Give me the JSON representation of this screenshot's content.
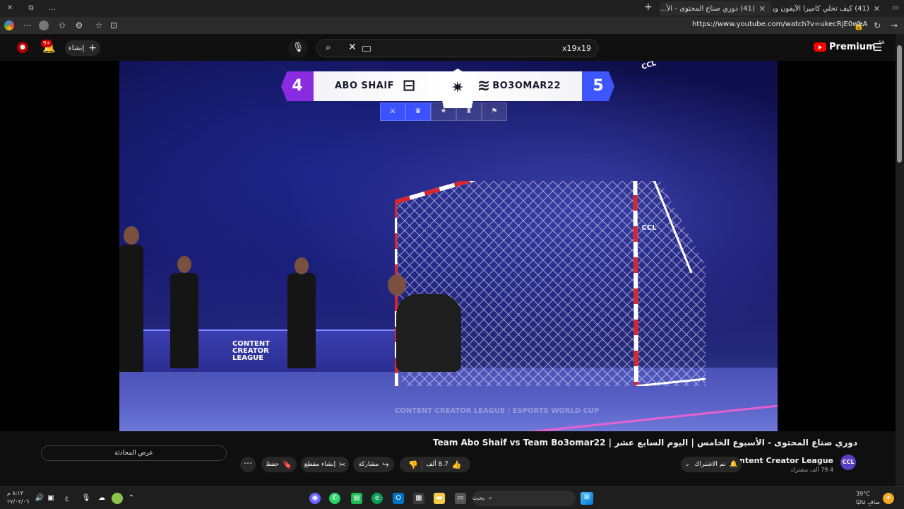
{
  "browser": {
    "tabs": [
      {
        "title": "(41) كيف تخلي كاميرا الآيفون ويب ...",
        "active": false
      },
      {
        "title": "(41) دوري صناع المحتوى - الأ...",
        "active": true
      }
    ],
    "url": "https://www.youtube.com/watch?v=ukecRjE0weA"
  },
  "header": {
    "create_label": "إنشاء",
    "notification_count": "9+",
    "search_value": "x19x19",
    "premium_label": "Premium",
    "region": "SA"
  },
  "video": {
    "scoreboard": {
      "left_team": "ABO SHAIF",
      "left_score": "4",
      "right_team": "BO3OMAR22",
      "right_score": "5"
    },
    "sponsor_text": "CONTENT CREATOR LEAGUE",
    "watermark": "CONTENT CREATOR LEAGUE / ESPORTS WORLD CUP"
  },
  "below": {
    "title": "دوري صناع المحتوى - الأسبوع الخامس | اليوم السابع عشر | Team Abo Shaif vs Team Bo3omar22",
    "chat_button": "عرض المحادثة",
    "channel_name": "Content Creator League",
    "subscribers": "79.4 ألف مشترك",
    "subscribed_label": "تم الاشتراك",
    "like_count": "8.7 ألف",
    "share_label": "مشاركة",
    "clip_label": "إنشاء مقطع",
    "save_label": "حفظ"
  },
  "taskbar": {
    "search_label": "بحث",
    "temperature": "39°C",
    "weather": "صافٍ غالبًا",
    "lang": "ع",
    "time": "٨:١٣ م",
    "date": "٢٧/٠٣/٠٦"
  },
  "colors": {
    "yt_red": "#ff0000",
    "left_team": "#8a2be2",
    "right_team": "#3f56ff"
  }
}
